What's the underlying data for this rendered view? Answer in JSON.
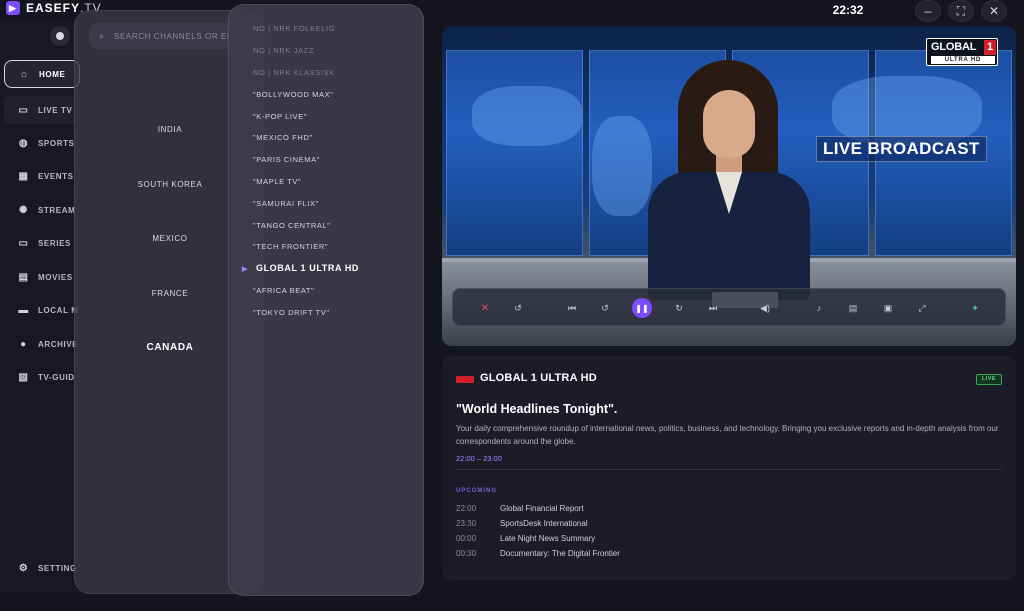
{
  "app": {
    "brand": "EASEFY",
    "brand_suffix": ".TV",
    "clock": "22:32"
  },
  "window_controls": {
    "minimize": "–",
    "maximize": "⛶",
    "close": "✕"
  },
  "sidebar": {
    "items": [
      {
        "label": "HOME",
        "icon": "home-icon"
      },
      {
        "label": "LIVE TV",
        "icon": "tv-icon"
      },
      {
        "label": "SPORTS",
        "icon": "ball-icon"
      },
      {
        "label": "EVENTS",
        "icon": "calendar-icon"
      },
      {
        "label": "STREAM",
        "icon": "stream-icon"
      },
      {
        "label": "SERIES",
        "icon": "monitor-icon"
      },
      {
        "label": "MOVIES",
        "icon": "film-icon"
      },
      {
        "label": "LOCAL M",
        "icon": "folder-icon"
      },
      {
        "label": "ARCHIVE",
        "icon": "archive-icon"
      },
      {
        "label": "TV-GUID",
        "icon": "guide-icon"
      }
    ],
    "settings_label": "SETTING"
  },
  "search": {
    "placeholder": "SEARCH CHANNELS OR EPG"
  },
  "countries": [
    "INDIA",
    "SOUTH KOREA",
    "MEXICO",
    "FRANCE",
    "CANADA"
  ],
  "selected_country": "CANADA",
  "channels": [
    "NO | NRK FOLKELIG",
    "NO | NRK JAZZ",
    "NO | NRK KLASSISK",
    "\"BOLLYWOOD MAX\"",
    "\"K-POP LIVE\"",
    "\"MEXICO FHD\"",
    "\"PARIS CINEMA\"",
    "\"MAPLE TV\"",
    "\"SAMURAI FLIX\"",
    "\"TANGO CENTRAL\"",
    "\"TECH FRONTIER\"",
    "GLOBAL 1 ULTRA HD",
    "\"AFRICA BEAT\"",
    "\"TOKYO DRIFT TV\""
  ],
  "now_playing_channel": "GLOBAL 1 ULTRA HD",
  "video": {
    "overlay_text": "LIVE BROADCAST",
    "logo_name": "GLOBAL",
    "logo_number": "1",
    "logo_sub": "ULTRA HD"
  },
  "player_controls": {
    "icons": [
      "close-icon",
      "replay-icon",
      "skip-previous-icon",
      "rewind-icon",
      "pause-icon",
      "forward-icon",
      "skip-next-icon",
      "volume-icon",
      "audio-track-icon",
      "subtitles-icon",
      "pip-icon",
      "fullscreen-icon",
      "cast-icon"
    ]
  },
  "program": {
    "channel": "GLOBAL 1 ULTRA HD",
    "badge": "LIVE",
    "title": "\"World Headlines Tonight\".",
    "description": "Your daily comprehensive roundup of international news, politics, business, and technology. Bringing you exclusive reports and in-depth analysis from our correspondents around the globe.",
    "time": "22:00 – 23:00"
  },
  "upcoming": {
    "label": "UPCOMING",
    "items": [
      {
        "time": "22:00",
        "title": "Global Financial Report"
      },
      {
        "time": "23:30",
        "title": "SportsDesk International"
      },
      {
        "time": "00:00",
        "title": "Late Night News Summary"
      },
      {
        "time": "00:30",
        "title": "Documentary: The Digital Frontier"
      }
    ]
  },
  "colors": {
    "accent": "#7c4dff",
    "live_green": "#58d47a",
    "logo_red": "#d0202a",
    "background": "#15151f"
  }
}
